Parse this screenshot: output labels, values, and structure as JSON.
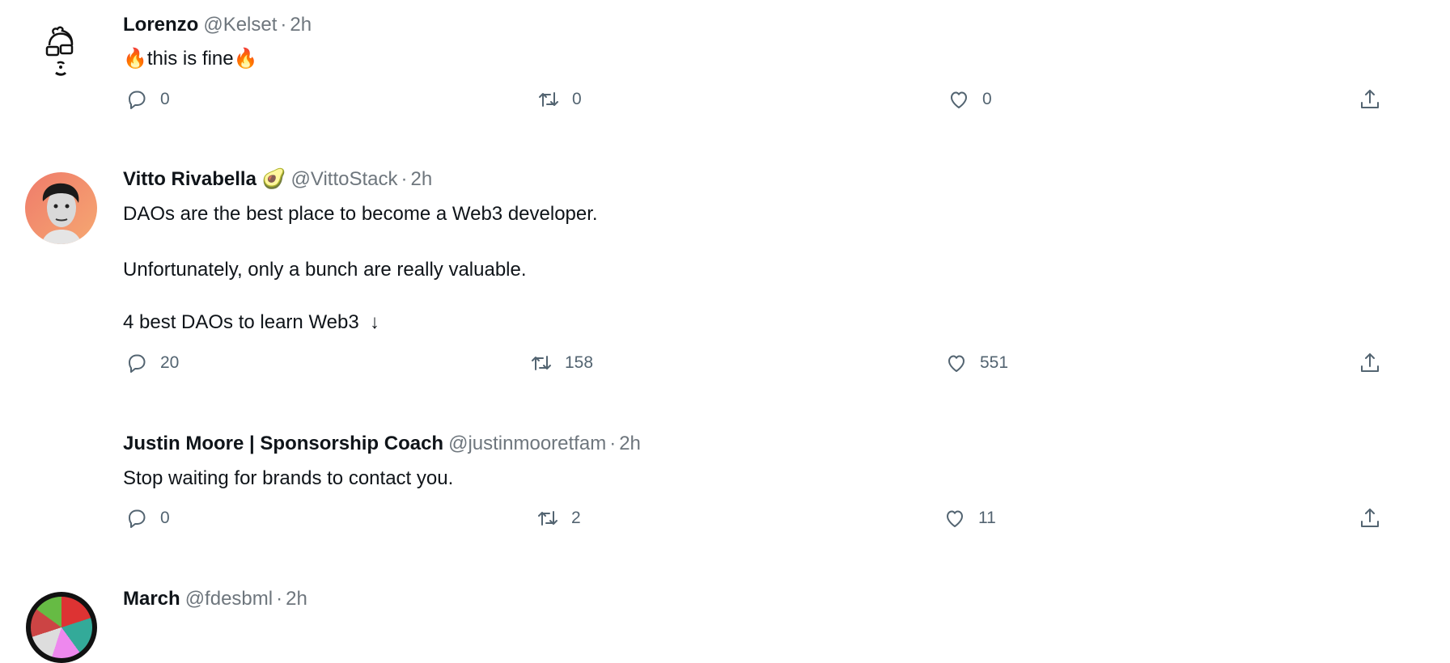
{
  "tweets": [
    {
      "name": "Lorenzo",
      "handle": "@Kelset",
      "time": "2h",
      "body": [
        "this is fine"
      ],
      "body_emoji": "🔥",
      "replies": "0",
      "retweets": "0",
      "likes": "0"
    },
    {
      "name": "Vitto Rivabella",
      "name_emoji": "🥑",
      "handle": "@VittoStack",
      "time": "2h",
      "body": [
        "DAOs are the best place to become a Web3 developer.",
        "Unfortunately, only a bunch are really valuable.",
        "4 best DAOs to learn Web3  ↓"
      ],
      "replies": "20",
      "retweets": "158",
      "likes": "551"
    },
    {
      "name": "Justin Moore | Sponsorship Coach",
      "handle": "@justinmooretfam",
      "time": "2h",
      "body": [
        "Stop waiting for brands to contact you."
      ],
      "replies": "0",
      "retweets": "2",
      "likes": "11"
    },
    {
      "name": "March",
      "handle": "@fdesbml",
      "time": "2h"
    }
  ],
  "separator": "·",
  "colors": {
    "text": "#0f1419",
    "muted": "#6e767d",
    "icon": "#536471"
  }
}
